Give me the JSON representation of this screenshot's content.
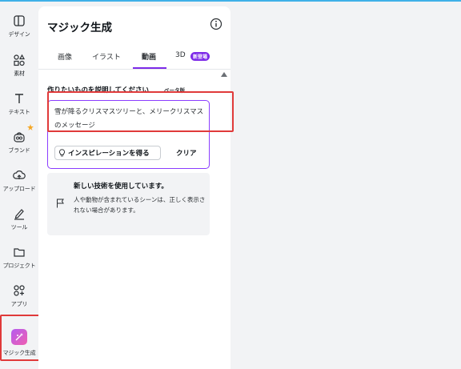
{
  "sidebar": {
    "items": [
      {
        "label": "デザイン",
        "icon": "layout-icon"
      },
      {
        "label": "素材",
        "icon": "elements-icon"
      },
      {
        "label": "テキスト",
        "icon": "text-icon"
      },
      {
        "label": "ブランド",
        "icon": "brand-icon"
      },
      {
        "label": "アップロード",
        "icon": "upload-icon"
      },
      {
        "label": "ツール",
        "icon": "draw-tool-icon"
      },
      {
        "label": "プロジェクト",
        "icon": "folder-icon"
      },
      {
        "label": "アプリ",
        "icon": "apps-icon"
      },
      {
        "label": "マジック生成",
        "icon": "magic-media-icon"
      }
    ],
    "active": "マジック生成"
  },
  "panel": {
    "title": "マジック生成",
    "tabs": [
      {
        "label": "画像"
      },
      {
        "label": "イラスト"
      },
      {
        "label": "動画"
      },
      {
        "label": "3D"
      }
    ],
    "active_tab": "動画",
    "new_badge": "新登場",
    "describe_label": "作りたいものを説明してください",
    "beta_label": "ベータ版",
    "prompt_text": "雪が降るクリスマスツリーと、メリークリスマスのメッセージ",
    "inspire_label": "インスピレーションを得る",
    "clear_label": "クリア",
    "notice": {
      "title": "新しい技術を使用しています。",
      "body": "人や動物が含まれているシーンは、正しく表示されない場合があります。"
    }
  },
  "colors": {
    "accent": "#7d2ae8",
    "highlight": "#e03a3a",
    "brand_star": "#f5a623"
  }
}
